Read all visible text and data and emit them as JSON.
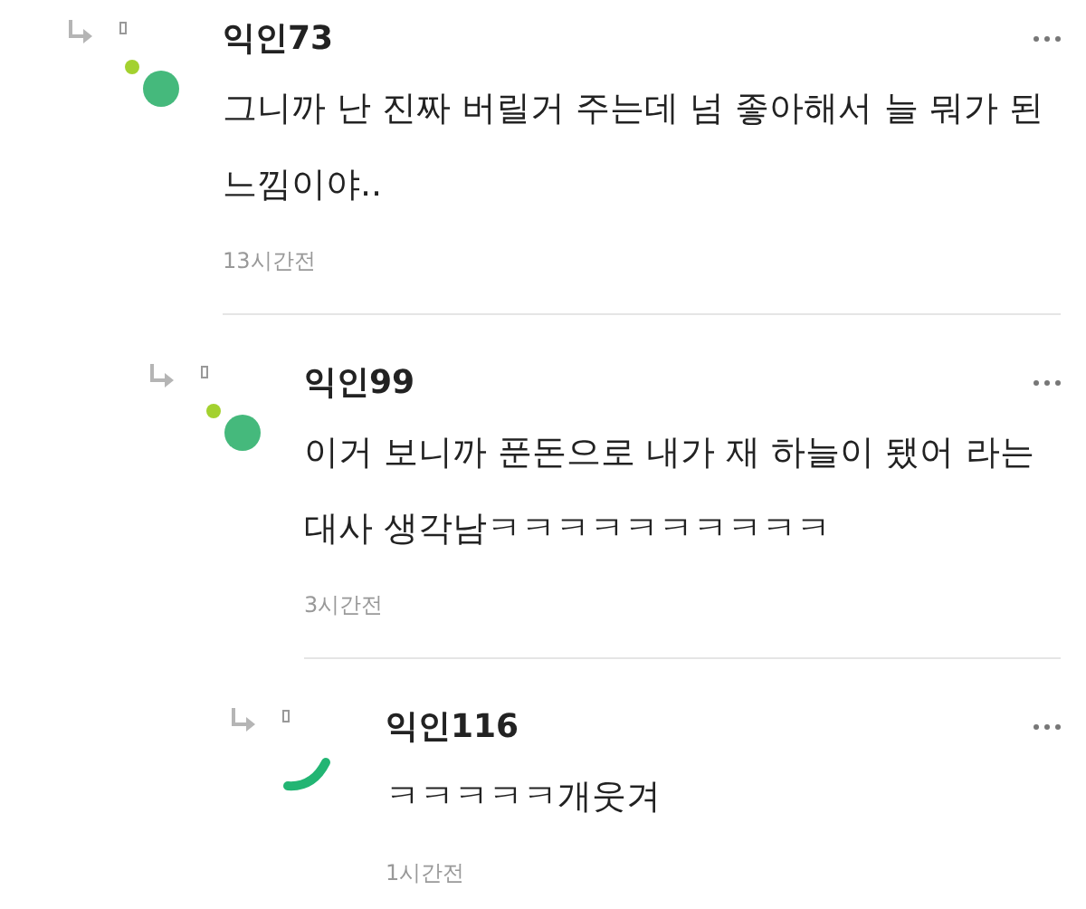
{
  "comments": [
    {
      "author": "익인73",
      "avatar": {
        "kind": "dots"
      },
      "text": "그니까 난 진짜 버릴거 주는데 넘 좋아해서 늘 뭐가 된 느낌이야..",
      "time": "13시간전",
      "children": [
        {
          "author": "익인99",
          "avatar": {
            "kind": "dots"
          },
          "text": "이거 보니까 푼돈으로 내가 재 하늘이 됐어 라는 대사 생각남ㅋㅋㅋㅋㅋㅋㅋㅋㅋㅋ",
          "time": "3시간전",
          "children": [
            {
              "author": "익인116",
              "avatar": {
                "kind": "arc"
              },
              "text": "ㅋㅋㅋㅋㅋ개웃겨",
              "time": "1시간전"
            }
          ]
        }
      ]
    }
  ]
}
